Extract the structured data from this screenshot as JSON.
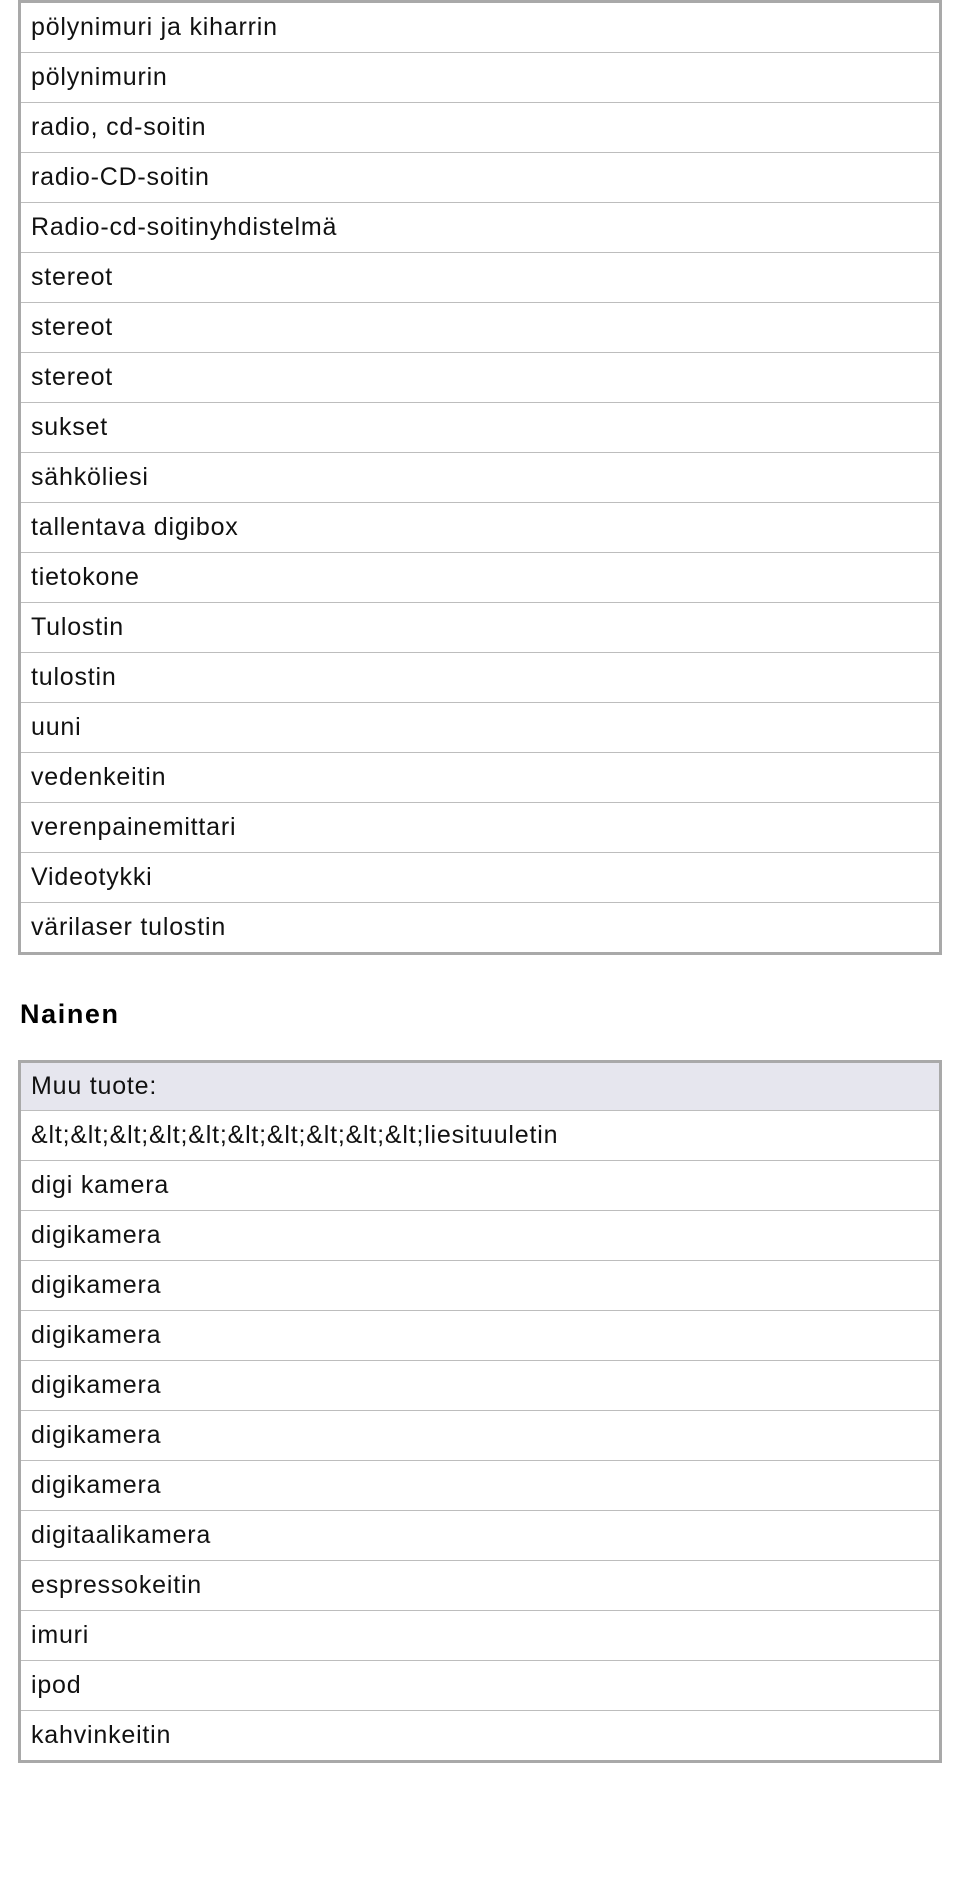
{
  "table1": {
    "rows": [
      "pölynimuri ja kiharrin",
      "pölynimurin",
      "radio, cd-soitin",
      "radio-CD-soitin",
      "Radio-cd-soitinyhdistelmä",
      "stereot",
      "stereot",
      "stereot",
      "sukset",
      "sähköliesi",
      "tallentava digibox",
      "tietokone",
      "Tulostin",
      "tulostin",
      "uuni",
      "vedenkeitin",
      "verenpainemittari",
      "Videotykki",
      "värilaser tulostin"
    ]
  },
  "section_heading": "Nainen",
  "table2": {
    "header": "Muu tuote:",
    "rows": [
      "&lt;&lt;&lt;&lt;&lt;&lt;&lt;&lt;&lt;&lt;liesituuletin",
      "digi kamera",
      "digikamera",
      "digikamera",
      "digikamera",
      "digikamera",
      "digikamera",
      "digikamera",
      "digitaalikamera",
      "espressokeitin",
      "imuri",
      "ipod",
      "kahvinkeitin"
    ]
  }
}
